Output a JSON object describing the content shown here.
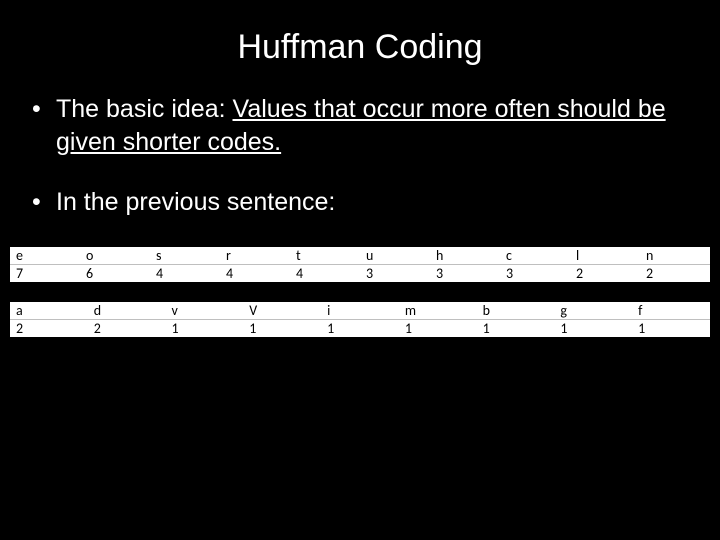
{
  "title": "Huffman Coding",
  "bullets": {
    "b1_prefix": "The basic idea: ",
    "b1_underlined": "Values that occur more often should be given shorter codes.",
    "b2": "In the previous sentence:"
  },
  "table1": {
    "letters": [
      "e",
      "o",
      "s",
      "r",
      "t",
      "u",
      "h",
      "c",
      "l",
      "n"
    ],
    "counts": [
      "7",
      "6",
      "4",
      "4",
      "4",
      "3",
      "3",
      "3",
      "2",
      "2"
    ]
  },
  "table2": {
    "letters": [
      "a",
      "d",
      "v",
      "V",
      "i",
      "m",
      "b",
      "g",
      "f"
    ],
    "counts": [
      "2",
      "2",
      "1",
      "1",
      "1",
      "1",
      "1",
      "1",
      "1"
    ]
  }
}
